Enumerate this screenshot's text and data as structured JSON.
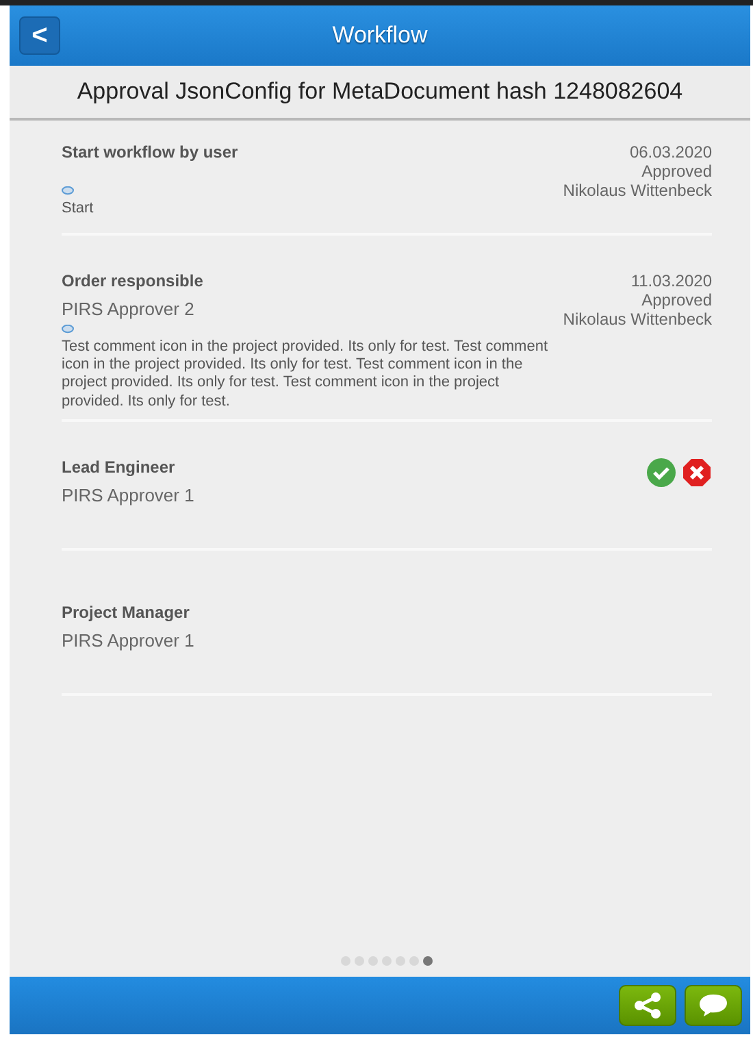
{
  "header": {
    "back_label": "<",
    "title": "Workflow"
  },
  "subtitle": "Approval JsonConfig for MetaDocument hash 1248082604",
  "steps": [
    {
      "kind": "done",
      "title": "Start workflow by user",
      "has_comment": true,
      "comment": "Start",
      "date": "06.03.2020",
      "status": "Approved",
      "user": "Nikolaus Wittenbeck"
    },
    {
      "kind": "done",
      "title": "Order responsible",
      "approver": "PIRS Approver 2",
      "has_comment": true,
      "comment": "Test comment icon in the project provided. Its only for test. Test comment icon in the project provided. Its only for test. Test comment icon in the project provided. Its only for test. Test comment icon in the project provided. Its only for test.",
      "date": "11.03.2020",
      "status": "Approved",
      "user": "Nikolaus Wittenbeck"
    },
    {
      "kind": "pending",
      "title": "Lead Engineer",
      "approver": "PIRS Approver 1",
      "has_comment": false,
      "actions": true
    },
    {
      "kind": "pending",
      "title": "Project Manager",
      "approver": "PIRS Approver 1",
      "has_comment": false,
      "actions": false
    }
  ],
  "pager": [
    {
      "selected": false
    },
    {
      "selected": false
    },
    {
      "selected": false
    },
    {
      "selected": false
    },
    {
      "selected": false
    },
    {
      "selected": false
    },
    {
      "selected": true
    }
  ]
}
